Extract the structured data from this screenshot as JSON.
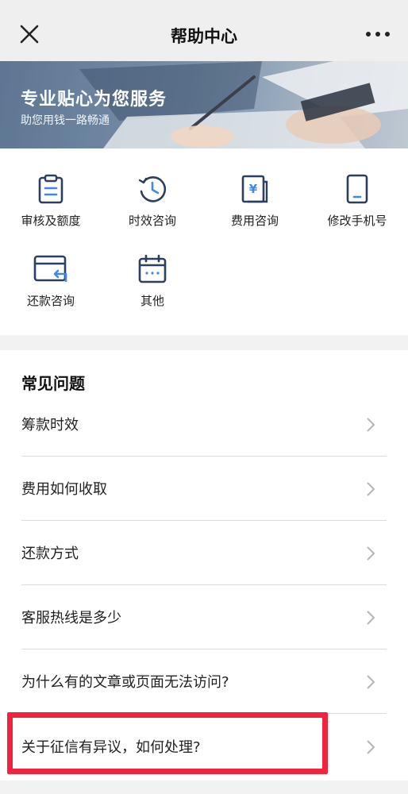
{
  "navbar": {
    "title": "帮助中心",
    "close_icon": "close-icon",
    "more_icon": "more-dots-icon"
  },
  "banner": {
    "title": "专业贴心为您服务",
    "subtitle": "助您用钱一路畅通"
  },
  "categories": [
    {
      "label": "审核及额度",
      "icon": "clipboard-icon"
    },
    {
      "label": "时效咨询",
      "icon": "clock-icon"
    },
    {
      "label": "费用咨询",
      "icon": "yen-document-icon"
    },
    {
      "label": "修改手机号",
      "icon": "phone-icon"
    },
    {
      "label": "还款咨询",
      "icon": "card-return-icon"
    },
    {
      "label": "其他",
      "icon": "calendar-icon"
    }
  ],
  "faq": {
    "heading": "常见问题",
    "items": [
      "筹款时效",
      "费用如何收取",
      "还款方式",
      "客服热线是多少",
      "为什么有的文章或页面无法访问?",
      "关于征信有异议，如何处理?"
    ]
  },
  "colors": {
    "icon_navy": "#2c3f5e",
    "icon_blue": "#3f8ae0",
    "highlight_red": "#f0243d"
  }
}
